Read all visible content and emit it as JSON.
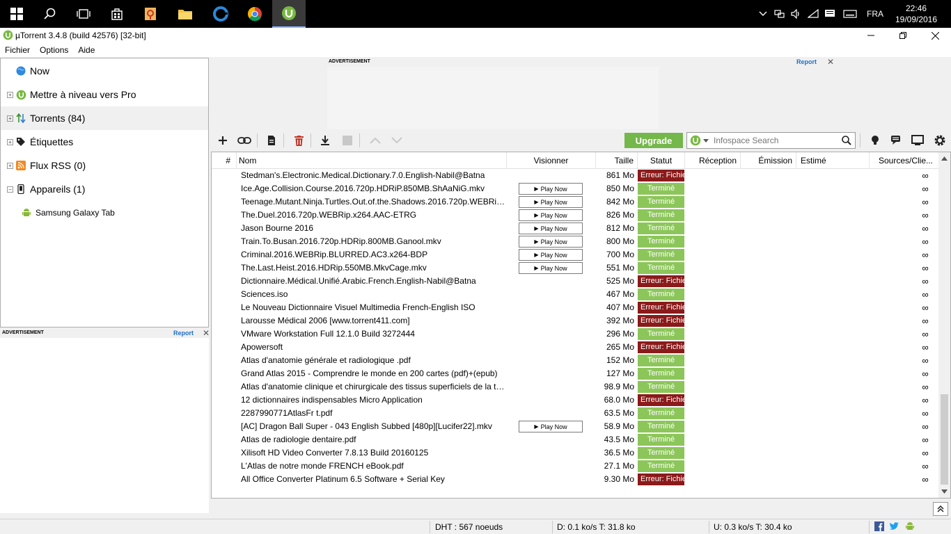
{
  "taskbar": {
    "time": "22:46",
    "date": "19/09/2016",
    "lang": "FRA"
  },
  "window": {
    "title": "µTorrent 3.4.8  (build 42576) [32-bit]",
    "menu": [
      "Fichier",
      "Options",
      "Aide"
    ]
  },
  "sidebar": {
    "now": "Now",
    "upgrade_pro": "Mettre à niveau vers Pro",
    "torrents": "Torrents (84)",
    "labels": "Étiquettes",
    "rss": "Flux RSS (0)",
    "devices": "Appareils (1)",
    "device_name": "Samsung Galaxy Tab"
  },
  "ads": {
    "label": "ADVERTISEMENT",
    "report": "Report"
  },
  "toolbar": {
    "upgrade": "Upgrade",
    "search_placeholder": "Infospace Search"
  },
  "columns": {
    "num": "#",
    "name": "Nom",
    "watch": "Visionner",
    "size": "Taille",
    "status": "Statut",
    "down": "Réception",
    "up": "Émission",
    "eta": "Estimé",
    "sources": "Sources/Clie..."
  },
  "play_label": "Play Now",
  "torrents": [
    {
      "name": "Stedman's.Electronic.Medical.Dictionary.7.0.English-Nabil@Batna",
      "size": "861 Mo",
      "status": "Erreur: Fichie",
      "state": "err",
      "play": false,
      "src": "∞"
    },
    {
      "name": "Ice.Age.Collision.Course.2016.720p.HDRiP.850MB.ShAaNiG.mkv",
      "size": "850 Mo",
      "status": "Terminé",
      "state": "ok",
      "play": true,
      "src": "∞"
    },
    {
      "name": "Teenage.Mutant.Ninja.Turtles.Out.of.the.Shadows.2016.720p.WEBRip.x...",
      "size": "842 Mo",
      "status": "Terminé",
      "state": "ok",
      "play": true,
      "src": "∞"
    },
    {
      "name": "The.Duel.2016.720p.WEBRip.x264.AAC-ETRG",
      "size": "826 Mo",
      "status": "Terminé",
      "state": "ok",
      "play": true,
      "src": "∞"
    },
    {
      "name": "Jason Bourne 2016",
      "size": "812 Mo",
      "status": "Terminé",
      "state": "ok",
      "play": true,
      "src": "∞"
    },
    {
      "name": "Train.To.Busan.2016.720p.HDRip.800MB.Ganool.mkv",
      "size": "800 Mo",
      "status": "Terminé",
      "state": "ok",
      "play": true,
      "src": "∞"
    },
    {
      "name": "Criminal.2016.WEBRip.BLURRED.AC3.x264-BDP",
      "size": "700 Mo",
      "status": "Terminé",
      "state": "ok",
      "play": true,
      "src": "∞"
    },
    {
      "name": "The.Last.Heist.2016.HDRip.550MB.MkvCage.mkv",
      "size": "551 Mo",
      "status": "Terminé",
      "state": "ok",
      "play": true,
      "src": "∞"
    },
    {
      "name": "Dictionnaire.Médical.Unifié.Arabic.French.English-Nabil@Batna",
      "size": "525 Mo",
      "status": "Erreur: Fichie",
      "state": "err",
      "play": false,
      "src": "∞"
    },
    {
      "name": "Sciences.iso",
      "size": "467 Mo",
      "status": "Terminé",
      "state": "ok",
      "play": false,
      "src": "∞"
    },
    {
      "name": "Le Nouveau Dictionnaire Visuel Multimedia French-English  ISO",
      "size": "407 Mo",
      "status": "Erreur: Fichie",
      "state": "err",
      "play": false,
      "src": "∞"
    },
    {
      "name": "Larousse Médical 2006 [www.torrent411.com]",
      "size": "392 Mo",
      "status": "Erreur: Fichie",
      "state": "err",
      "play": false,
      "src": "∞"
    },
    {
      "name": "VMware Workstation Full 12.1.0 Build 3272444",
      "size": "296 Mo",
      "status": "Terminé",
      "state": "ok",
      "play": false,
      "src": "∞"
    },
    {
      "name": "Apowersoft",
      "size": "265 Mo",
      "status": "Erreur: Fichie",
      "state": "err",
      "play": false,
      "src": "∞"
    },
    {
      "name": "Atlas d'anatomie générale et radiologique .pdf",
      "size": "152 Mo",
      "status": "Terminé",
      "state": "ok",
      "play": false,
      "src": "∞"
    },
    {
      "name": "Grand Atlas 2015 - Comprendre le monde en 200 cartes (pdf)+(epub)",
      "size": "127 Mo",
      "status": "Terminé",
      "state": "ok",
      "play": false,
      "src": "∞"
    },
    {
      "name": "Atlas d'anatomie clinique et chirurgicale des tissus superficiels de la têt...",
      "size": "98.9 Mo",
      "status": "Terminé",
      "state": "ok",
      "play": false,
      "src": "∞"
    },
    {
      "name": "12 dictionnaires indispensables Micro Application",
      "size": "68.0 Mo",
      "status": "Erreur: Fichie",
      "state": "err",
      "play": false,
      "src": "∞"
    },
    {
      "name": "2287990771AtlasFr t.pdf",
      "size": "63.5 Mo",
      "status": "Terminé",
      "state": "ok",
      "play": false,
      "src": "∞"
    },
    {
      "name": "[AC] Dragon Ball Super - 043 English Subbed [480p][Lucifer22].mkv",
      "size": "58.9 Mo",
      "status": "Terminé",
      "state": "ok",
      "play": true,
      "src": "∞"
    },
    {
      "name": "Atlas de radiologie dentaire.pdf",
      "size": "43.5 Mo",
      "status": "Terminé",
      "state": "ok",
      "play": false,
      "src": "∞"
    },
    {
      "name": "Xilisoft HD Video Converter 7.8.13 Build 20160125",
      "size": "36.5 Mo",
      "status": "Terminé",
      "state": "ok",
      "play": false,
      "src": "∞"
    },
    {
      "name": "L'Atlas de notre monde FRENCH eBook.pdf",
      "size": "27.1 Mo",
      "status": "Terminé",
      "state": "ok",
      "play": false,
      "src": "∞"
    },
    {
      "name": "All Office Converter Platinum 6.5 Software + Serial Key",
      "size": "9.30 Mo",
      "status": "Erreur: Fichie",
      "state": "err",
      "play": false,
      "src": "∞"
    }
  ],
  "statusbar": {
    "dht": "DHT : 567 noeuds",
    "down": "D: 0.1 ko/s T: 31.8 ko",
    "up": "U: 0.3 ko/s T: 30.4 ko"
  },
  "colors": {
    "ok": "#8cc65a",
    "err": "#8b1a1a",
    "upgrade": "#74b74a"
  }
}
